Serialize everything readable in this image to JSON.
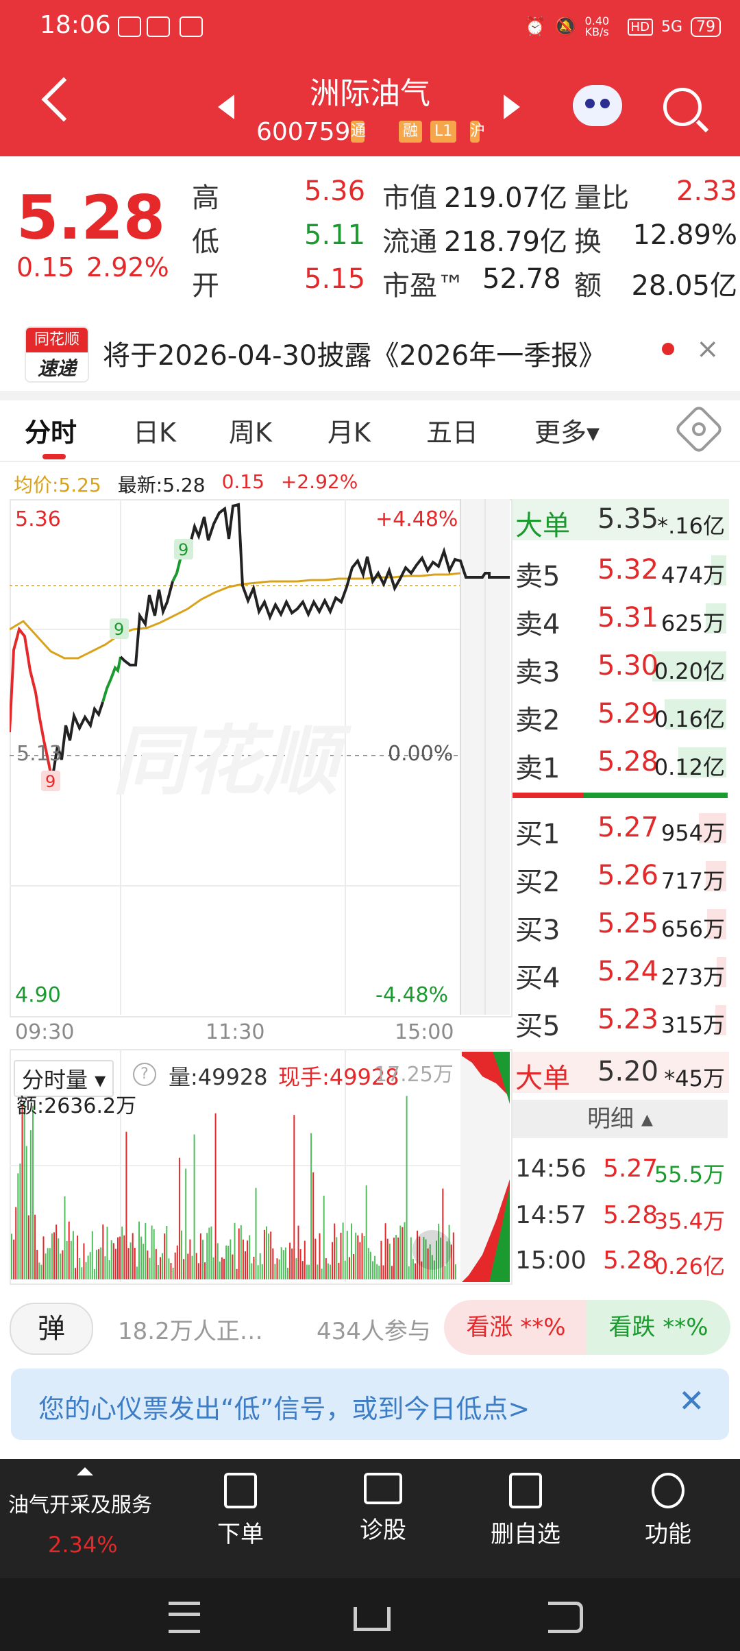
{
  "status": {
    "time": "18:06",
    "net_speed": "0.40 KB/s",
    "signal": "5G",
    "battery": "79",
    "hd": "HD"
  },
  "header": {
    "stock_name": "洲际油气",
    "stock_code": "600759",
    "tags": [
      "通",
      "融",
      "L1",
      "沪"
    ]
  },
  "quote": {
    "price": "5.28",
    "change": "0.15",
    "change_pct": "2.92%",
    "grid": [
      {
        "l1": "高",
        "v1": "5.36",
        "l2": "市值",
        "v2": "219.07亿",
        "l3": "量比",
        "v3": "2.33"
      },
      {
        "l1": "低",
        "v1": "5.11",
        "l2": "流通",
        "v2": "218.79亿",
        "l3": "换",
        "v3": "12.89%"
      },
      {
        "l1": "开",
        "v1": "5.15",
        "l2": "市盈™",
        "v2": "52.78",
        "l3": "额",
        "v3": "28.05亿"
      }
    ]
  },
  "notice": {
    "logo_top": "同花顺",
    "logo_bottom": "速递",
    "text": "将于2026-04-30披露《2026年一季报》",
    "close": "×"
  },
  "tabs": [
    "分时",
    "日K",
    "周K",
    "月K",
    "五日",
    "更多▾"
  ],
  "chart_info": {
    "avg_label": "均价:5.25",
    "latest_label": "最新:5.28",
    "change": "0.15",
    "change_pct": "+2.92%"
  },
  "chart_axes": {
    "top_price": "5.36",
    "top_pct": "+4.48%",
    "mid_price": "5.13",
    "mid_pct": "0.00%",
    "bottom_price": "4.90",
    "bottom_pct": "-4.48%",
    "times": [
      "09:30",
      "11:30",
      "15:00"
    ],
    "markers": [
      "9",
      "9",
      "9"
    ],
    "watermark": "同花顺"
  },
  "volume": {
    "label": "分时量 ▾",
    "help": "?",
    "vol": "量:49928",
    "now_hand": "现手:49928",
    "right": "17.25万",
    "amount": "额:2636.2万"
  },
  "order_book": {
    "big_sell": {
      "label": "大单",
      "price": "5.35",
      "vol": "*.16亿"
    },
    "sells": [
      {
        "label": "卖5",
        "price": "5.32",
        "vol": "474万"
      },
      {
        "label": "卖4",
        "price": "5.31",
        "vol": "625万"
      },
      {
        "label": "卖3",
        "price": "5.30",
        "vol": "0.20亿"
      },
      {
        "label": "卖2",
        "price": "5.29",
        "vol": "0.16亿"
      },
      {
        "label": "卖1",
        "price": "5.28",
        "vol": "0.12亿"
      }
    ],
    "buys": [
      {
        "label": "买1",
        "price": "5.27",
        "vol": "954万"
      },
      {
        "label": "买2",
        "price": "5.26",
        "vol": "717万"
      },
      {
        "label": "买3",
        "price": "5.25",
        "vol": "656万"
      },
      {
        "label": "买4",
        "price": "5.24",
        "vol": "273万"
      },
      {
        "label": "买5",
        "price": "5.23",
        "vol": "315万"
      }
    ],
    "big_buy": {
      "label": "大单",
      "price": "5.20",
      "vol": "*45万"
    },
    "detail_label": "明细 ▴",
    "ticks": [
      {
        "time": "14:56",
        "price": "5.27",
        "vol": "55.5万"
      },
      {
        "time": "14:57",
        "price": "5.28",
        "vol": "35.4万"
      },
      {
        "time": "15:00",
        "price": "5.28",
        "vol": "0.26亿"
      }
    ]
  },
  "vote": {
    "danmu": "弹",
    "viewers": "18.2万人正…",
    "participants": "434人参与",
    "up": "看涨 **%",
    "down": "看跌 **%"
  },
  "signal": {
    "text": "您的心仪票发出“低”信号，或到今日低点>",
    "close": "✕"
  },
  "bottom_nav": {
    "sector_name": "油气开采及服务",
    "sector_pct": "2.34%",
    "items": [
      "下单",
      "诊股",
      "删自选",
      "功能"
    ]
  }
}
